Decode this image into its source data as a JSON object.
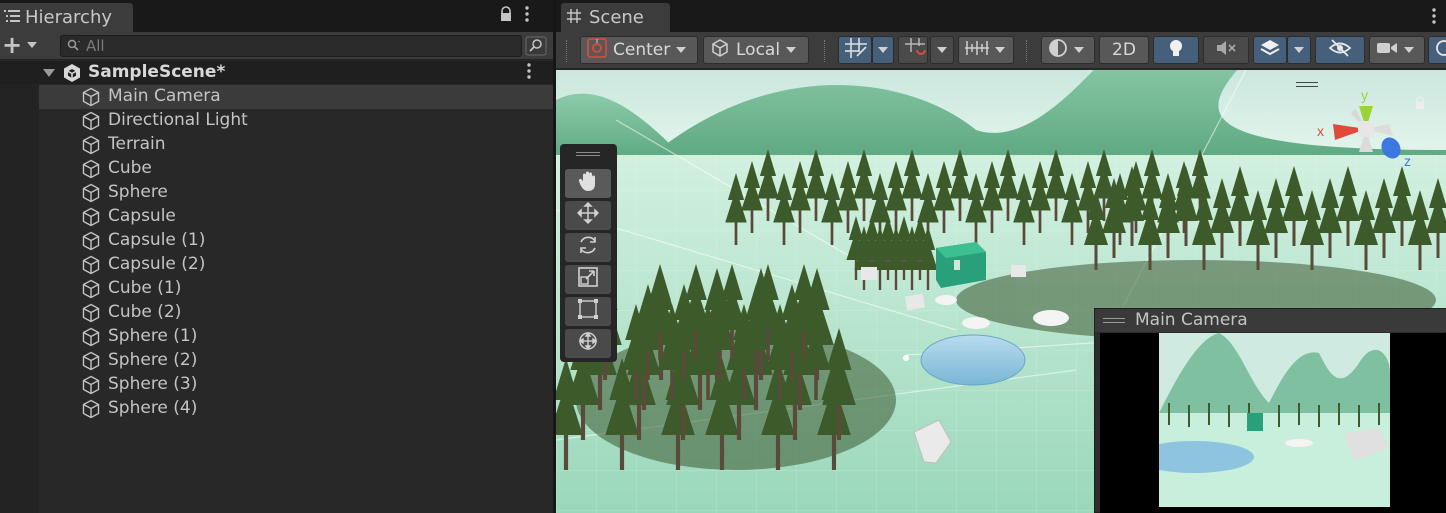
{
  "hierarchy": {
    "tab_title": "Hierarchy",
    "search_placeholder": "All",
    "scene_name": "SampleScene*",
    "items": [
      {
        "label": "Main Camera"
      },
      {
        "label": "Directional Light"
      },
      {
        "label": "Terrain"
      },
      {
        "label": "Cube"
      },
      {
        "label": "Sphere"
      },
      {
        "label": "Capsule"
      },
      {
        "label": "Capsule (1)"
      },
      {
        "label": "Capsule (2)"
      },
      {
        "label": "Cube (1)"
      },
      {
        "label": "Cube (2)"
      },
      {
        "label": "Sphere (1)"
      },
      {
        "label": "Sphere (2)"
      },
      {
        "label": "Sphere (3)"
      },
      {
        "label": "Sphere (4)"
      }
    ],
    "selected_item": "Main Camera"
  },
  "scene": {
    "tab_title": "Scene",
    "pivot_mode": "Center",
    "pivot_rotation": "Local",
    "mode_2d_label": "2D",
    "camera_preview_title": "Main Camera",
    "gizmo_axes": {
      "y": "y",
      "x": "x",
      "z": "z"
    }
  },
  "colors": {
    "panel_bg": "#282828",
    "toolbar_bg": "#3c3c3c",
    "active_button": "#46607c",
    "selection_row": "#3b3b3b",
    "axis_x": "#e04a3a",
    "axis_y": "#9bd33b",
    "axis_z": "#3c78e0"
  }
}
